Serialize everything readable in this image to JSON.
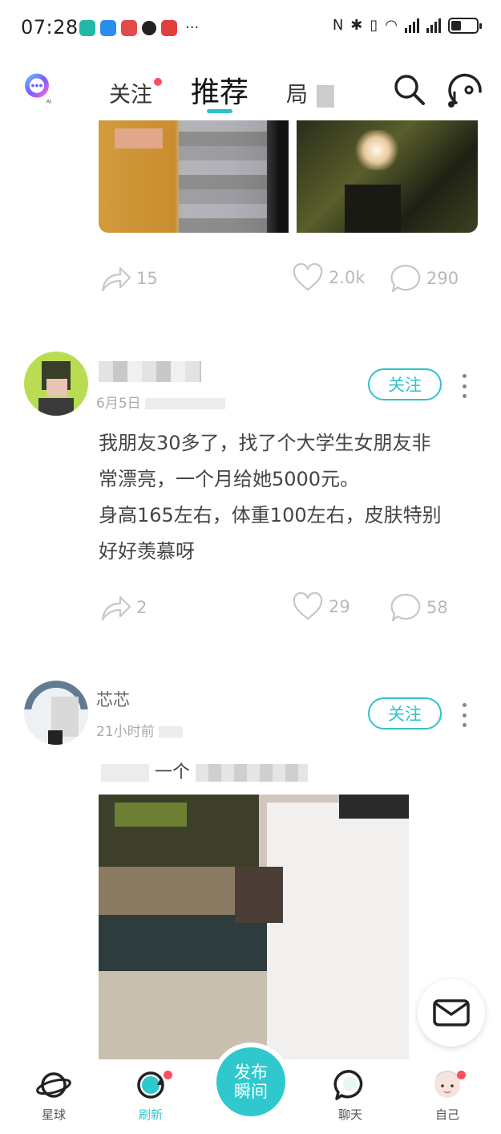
{
  "status_bar": {
    "time": "07:28",
    "more": "···"
  },
  "nav": {
    "tabs": [
      {
        "label": "关注",
        "has_dot": true
      },
      {
        "label": "推荐",
        "active": true
      },
      {
        "label": "局"
      }
    ]
  },
  "posts": [
    {
      "actions": {
        "share_count": "15",
        "like_count": "2.0k",
        "comment_count": "290"
      }
    },
    {
      "time_prefix": "6月5日",
      "follow_label": "关注",
      "text_lines": [
        "我朋友30多了，找了个大学生女朋友非",
        "常漂亮，一个月给她5000元。",
        "身高165左右，体重100左右，皮肤特别",
        "好好羡慕呀"
      ],
      "actions": {
        "share_count": "2",
        "like_count": "29",
        "comment_count": "58"
      }
    },
    {
      "username": "芯芯",
      "time_prefix": "21小时前",
      "follow_label": "关注",
      "caption_fragment": "一个"
    }
  ],
  "bottom_nav": {
    "items": [
      {
        "label": "星球"
      },
      {
        "label": "刷新",
        "active": true
      },
      {
        "label": "发布瞬间"
      },
      {
        "label": "聊天"
      },
      {
        "label": "自己"
      }
    ],
    "publish_line1": "发布",
    "publish_line2": "瞬间"
  },
  "colors": {
    "accent": "#2fc3c8",
    "badge": "#ff4d5e"
  }
}
